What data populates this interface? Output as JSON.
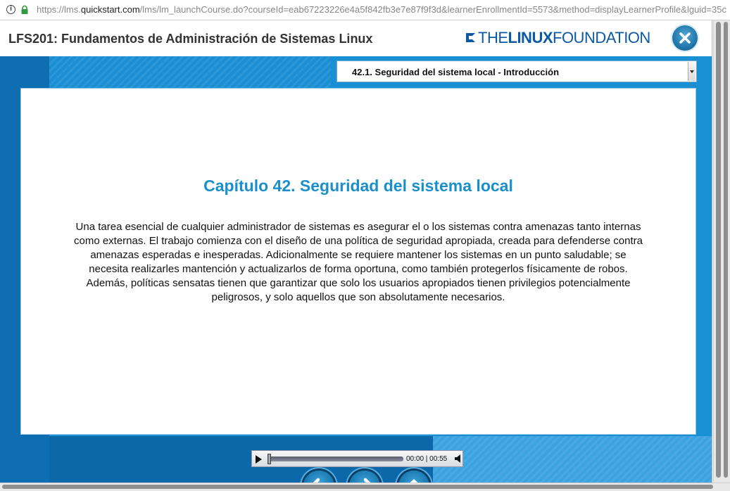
{
  "browser": {
    "url_prefix": "https://lms.",
    "url_domain": "quickstart.com",
    "url_rest": "/lms/lm_launchCourse.do?courseId=eab67223226e4a5f842fb3e7e87f9f3d&learnerEnrollmentId=5573&method=displayLearnerProfile&lguid=35c",
    "info_glyph": "i"
  },
  "course": {
    "title": "LFS201: Fundamentos de Administración de Sistemas Linux",
    "logo": {
      "the": "THE",
      "linux": "LINUX",
      "foundation": "FOUNDATION"
    }
  },
  "chapter_select": {
    "selected": "42.1. Seguridad del sistema local - Introducción"
  },
  "content": {
    "heading": "Capítulo 42. Seguridad del sistema local",
    "body": "Una tarea esencial de cualquier administrador de sistemas es asegurar el o los sistemas contra amenazas tanto internas como externas. El trabajo comienza con el diseño de una política de seguridad apropiada, creada para defenderse contra amenazas esperadas e inesperadas. Adicionalmente se requiere mantener los sistemas en un punto saludable; se necesita realizarles mantención y actualizarlos de forma oportuna, como también protegerlos físicamente de robos. Además, políticas sensatas tienen que garantizar que solo los usuarios apropiados tienen privilegios potencialmente peligrosos, y solo aquellos que son absolutamente necesarios."
  },
  "audio": {
    "time": "00:00 | 00:55",
    "progress": 0
  },
  "navigation": {
    "icons": [
      "back-arrow-icon",
      "forward-arrow-icon",
      "home-icon"
    ]
  },
  "colors": {
    "accent": "#1b8fc9",
    "stage_blue": "#1a8fd3",
    "brand_blue": "#0b5aa3"
  }
}
